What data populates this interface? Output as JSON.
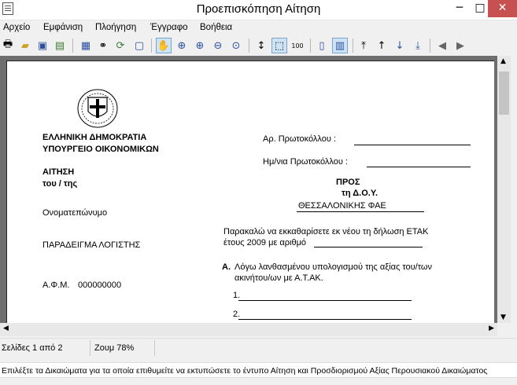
{
  "window": {
    "title": "Προεπισκόπηση Αίτηση",
    "minimize": "─",
    "maximize": "□",
    "close": "✕"
  },
  "menu": [
    "Αρχείο",
    "Εμφάνιση",
    "Πλοήγηση",
    "Έγγραφο",
    "Βοήθεια"
  ],
  "toolbar_icons": [
    "print-icon",
    "open-icon",
    "save-icon",
    "export-icon",
    "table-icon",
    "binoculars-icon",
    "refresh-icon",
    "properties-icon",
    "hand-icon",
    "zoom-in-icon",
    "zoom-in-2-icon",
    "zoom-out-icon",
    "zoom-text-icon",
    "fit-height-icon",
    "fit-page-icon",
    "zoom-100-icon",
    "single-page-icon",
    "two-page-icon",
    "first-page-icon",
    "previous-page-icon",
    "next-page-icon",
    "last-page-icon",
    "back-icon",
    "forward-icon"
  ],
  "document": {
    "org_line1": "ΕΛΛΗΝΙΚΗ ΔΗΜΟΚΡΑΤΙΑ",
    "org_line2": "ΥΠΟΥΡΓΕΙΟ ΟΙΚΟΝΟΜΙΚΩΝ",
    "protocol_no_label": "Αρ. Πρωτοκόλλου :",
    "protocol_date_label": "Ημ/νια Πρωτοκόλλου :",
    "application_title": "ΑΙΤΗΣΗ",
    "application_sub": "του  /  της",
    "to_label": "ΠΡΟΣ",
    "to_doy": "τη Δ.Ο.Υ.",
    "tax_office": "ΘΕΣΣΑΛΟΝΙΚΗΣ ΦΑΕ",
    "name_label": "Ονοματεπώνυμο",
    "name_value": "ΠΑΡΑΔΕΙΓΜΑ ΛΟΓΙΣΤΗΣ",
    "request_line1": "Παρακαλώ να  εκκαθαρίσετε εκ νέου τη δήλωση ΕΤΑΚ",
    "request_line2": "έτους 2009 με αριθμό",
    "section_letter": "Α.",
    "section_line1": "Λόγω  λανθασμένου  υπολογισμού της αξίας του/των",
    "section_line2": "ακινήτου/ων με Α.Τ.ΑΚ.",
    "item1": "1.",
    "item2": "2.",
    "afm_label": "Α.Φ.Μ.",
    "afm_value": "000000000"
  },
  "status": {
    "pages": "Σελίδες 1 από 2",
    "zoom": "Ζουμ 78%"
  },
  "hint": "Επιλέξτε τα Δικαιώματα για τα οποία επιθυμείτε να εκτυπώσετε το έντυπο Αίτηση και Προσδιορισμού Αξίας Περουσιακού Δικαιώματος"
}
